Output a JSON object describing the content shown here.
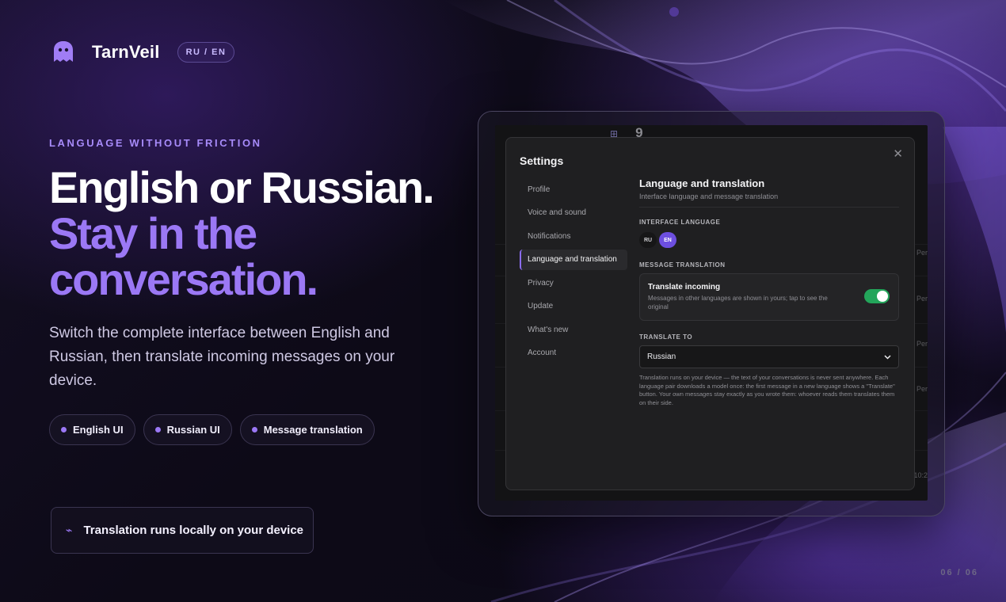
{
  "brand": {
    "name": "TarnVeil",
    "lang_switch": "RU / EN"
  },
  "hero": {
    "eyebrow": "LANGUAGE WITHOUT FRICTION",
    "headline_part1": "English or Russian.",
    "headline_accent": "Stay in the conversation.",
    "subtext": "Switch the complete interface between English and Russian, then translate incoming messages on your device.",
    "chips": [
      "English UI",
      "Russian UI",
      "Message translation"
    ],
    "local_note": "Translation runs locally on your device"
  },
  "pager": "06 / 06",
  "settings": {
    "title": "Settings",
    "close_icon": "close-icon",
    "nav": [
      "Profile",
      "Voice and sound",
      "Notifications",
      "Language and translation",
      "Privacy",
      "Update",
      "What's new",
      "Account"
    ],
    "active_nav": "Language and translation",
    "panel_title": "Language and translation",
    "panel_desc": "Interface language and message translation",
    "interface_language_label": "INTERFACE LANGUAGE",
    "interface_language_options": [
      "RU",
      "EN"
    ],
    "interface_language_selected": "EN",
    "message_translation_label": "MESSAGE TRANSLATION",
    "translate_incoming_title": "Translate incoming",
    "translate_incoming_desc": "Messages in other languages are shown in yours; tap to see the original",
    "translate_incoming_enabled": true,
    "translate_to_label": "TRANSLATE TO",
    "translate_to_value": "Russian",
    "footnote": "Translation runs on your device — the text of your conversations is never sent anywhere. Each language pair downloads a model once: the first message in a new language shows a \"Translate\" button. Your own messages stay exactly as you wrote them: whoever reads them translates them on their side."
  },
  "background_app": {
    "timestamps": [
      "Per",
      "Per",
      "Per",
      "Per",
      "10:2"
    ]
  },
  "colors": {
    "accent": "#9b78f5",
    "toggle_on": "#23a55a",
    "active_segment": "#6d4fe0"
  }
}
